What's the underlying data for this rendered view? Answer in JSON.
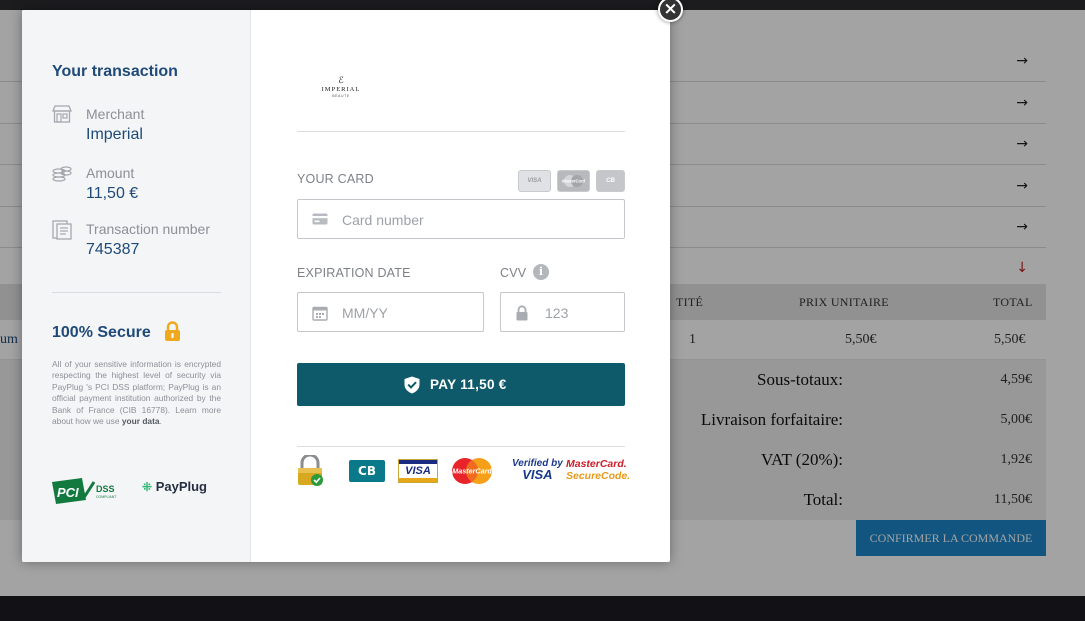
{
  "background": {
    "table_headers": {
      "qty": "TITÉ",
      "unit_price": "PRIX UNITAIRE",
      "total": "TOTAL"
    },
    "item": {
      "name_fragment": "um",
      "qty": "1",
      "unit_price": "5,50€",
      "total": "5,50€"
    },
    "summary": [
      {
        "label": "Sous-totaux:",
        "value": "4,59€"
      },
      {
        "label": "Livraison forfaitaire:",
        "value": "5,00€"
      },
      {
        "label": "VAT (20%):",
        "value": "1,92€"
      },
      {
        "label": "Total:",
        "value": "11,50€"
      }
    ],
    "confirm_label": "CONFIRMER LA COMMANDE"
  },
  "modal": {
    "close_glyph": "×",
    "sidebar": {
      "title": "Your transaction",
      "merchant_label": "Merchant",
      "merchant_value": "Imperial",
      "amount_label": "Amount",
      "amount_value": "11,50 €",
      "transaction_label": "Transaction number",
      "transaction_value": "745387",
      "secure_title": "100% Secure",
      "secure_text": "All of your sensitive information is encrypted respecting the highest level of security via PayPlug 's PCI DSS platform; PayPlug is an official payment institution authorized by the Bank of France (CIB 16778). Learn more about how we use",
      "secure_link": "your data",
      "secure_end": ".",
      "pci_text": "PCI",
      "dss_text": "DSS",
      "dss_sub": "COMPLIANT",
      "payplug_text": "PayPlug"
    },
    "form": {
      "logo_mark": "ℰ",
      "logo_name": "IMPERIAL",
      "logo_sub": "BEAUTE",
      "card_label": "YOUR CARD",
      "brand_visa": "VISA",
      "brand_mc": "MasterCard",
      "brand_cb": "CB",
      "card_placeholder": "Card number",
      "exp_label": "EXPIRATION DATE",
      "exp_placeholder": "MM/YY",
      "cvv_label": "CVV",
      "cvv_info_glyph": "i",
      "cvv_placeholder": "123",
      "pay_label": "PAY 11,50 €"
    },
    "trust_logos": {
      "cb": "CB",
      "visa": "VISA",
      "mc": "MasterCard",
      "vbv_top": "Verified by",
      "vbv_bottom": "VISA",
      "mcsc_top": "MasterCard.",
      "mcsc_bottom": "SecureCode."
    }
  },
  "colors": {
    "brand_navy": "#1f4a78",
    "pay_button": "#0f5a6a",
    "secure_lock": "#f0a81e",
    "confirm_button": "#1c85c8"
  },
  "icons": [
    "store-icon",
    "coins-icon",
    "receipt-icon",
    "lock-icon",
    "card-icon",
    "calendar-icon",
    "padlock-icon",
    "info-icon",
    "shield-check-icon",
    "arrow-right-icon",
    "arrow-down-icon",
    "close-icon"
  ]
}
